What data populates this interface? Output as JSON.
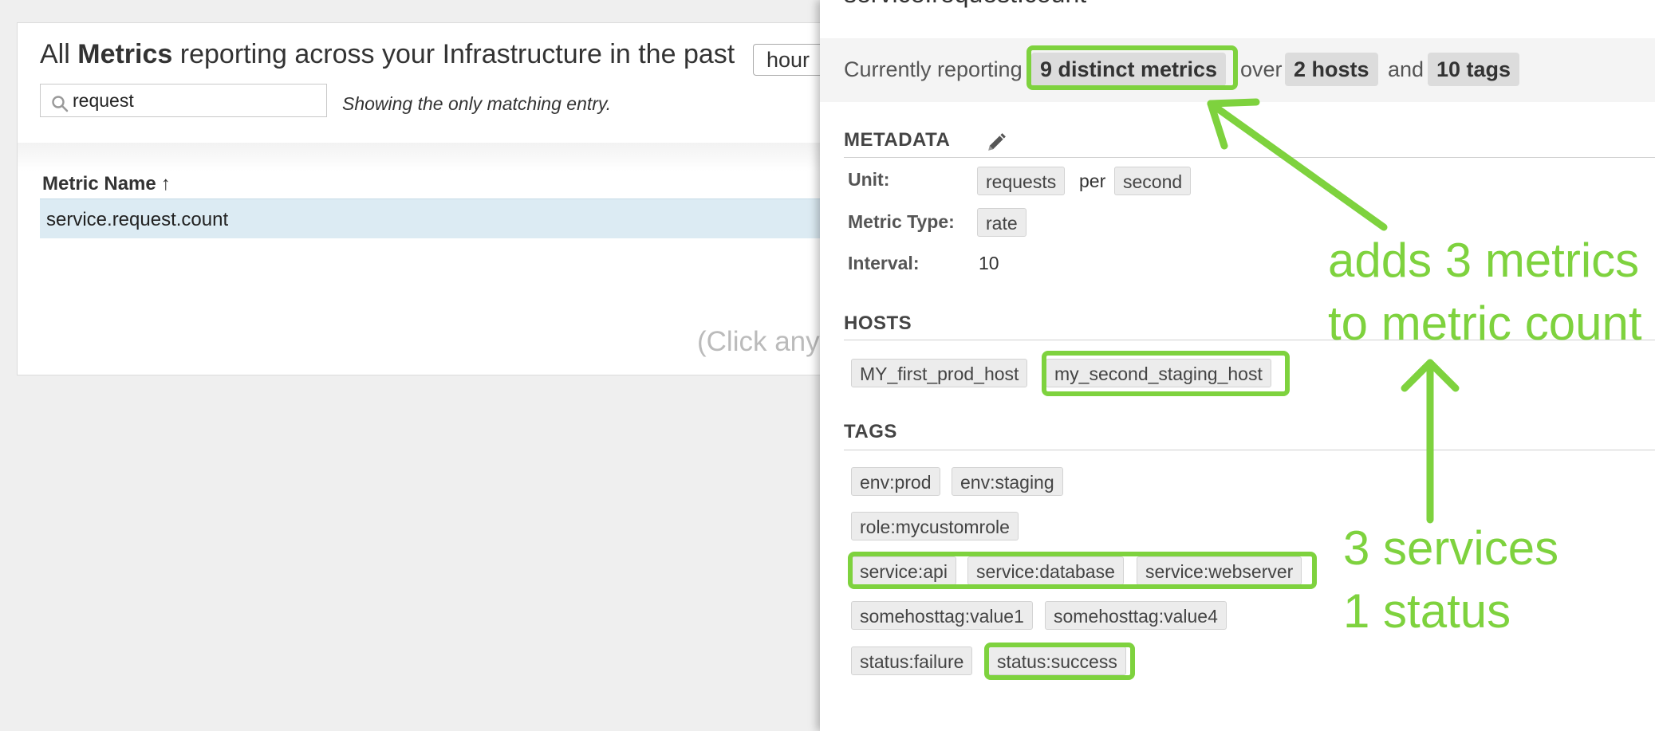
{
  "metrics_list": {
    "heading_prefix": "All",
    "heading_bold": "Metrics",
    "heading_suffix": "reporting across your Infrastructure in the past",
    "timeframe_value": "hour",
    "search": {
      "value": "request"
    },
    "match_note": "Showing the only matching entry.",
    "column_header": "Metric Name",
    "sort_arrow": "↑",
    "rows": [
      "service.request.count"
    ],
    "click_hint": "(Click any"
  },
  "detail_panel": {
    "title": "service.request.count",
    "summary": {
      "prefix": "Currently reporting",
      "metrics_pill": "9 distinct metrics",
      "over": "over",
      "hosts_pill": "2 hosts",
      "and": "and",
      "tags_pill": "10 tags"
    },
    "metadata": {
      "title": "METADATA",
      "unit_label": "Unit:",
      "unit_value": "requests",
      "unit_per": "per",
      "unit_per_value": "second",
      "type_label": "Metric Type:",
      "type_value": "rate",
      "interval_label": "Interval:",
      "interval_value": "10"
    },
    "hosts": {
      "title": "HOSTS",
      "items": [
        "MY_first_prod_host",
        "my_second_staging_host"
      ]
    },
    "tags": {
      "title": "TAGS",
      "rows": [
        [
          "env:prod",
          "env:staging"
        ],
        [
          "role:mycustomrole"
        ],
        [
          "service:api",
          "service:database",
          "service:webserver"
        ],
        [
          "somehosttag:value1",
          "somehosttag:value4"
        ],
        [
          "status:failure",
          "status:success"
        ]
      ]
    }
  },
  "annotations": {
    "top_line1": "adds 3 metrics",
    "top_line2": "to metric count",
    "bottom_line1": "3 services",
    "bottom_line2": "1 status",
    "color": "#7ed23e"
  }
}
